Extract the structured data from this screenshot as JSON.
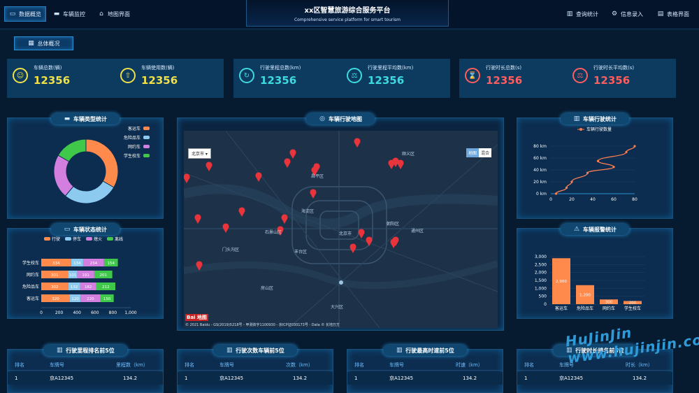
{
  "header": {
    "title": "xx区智慧旅游综合服务平台",
    "subtitle": "Comprehensive service platform for smart tourism",
    "nav_left": [
      {
        "label": "数据概览",
        "icon": "monitor-icon"
      },
      {
        "label": "车辆监控",
        "icon": "car-icon"
      },
      {
        "label": "地图界面",
        "icon": "building-icon"
      }
    ],
    "nav_right": [
      {
        "label": "查询统计",
        "icon": "bar-chart-icon"
      },
      {
        "label": "信息录入",
        "icon": "gear-icon"
      },
      {
        "label": "表格界面",
        "icon": "table-icon"
      }
    ]
  },
  "overview_tab": "总体概况",
  "kpis": [
    {
      "label": "车辆总数(辆)",
      "value": "12356",
      "color": "#f0e04a"
    },
    {
      "label": "车辆使用数(辆)",
      "value": "12356",
      "color": "#f0e04a"
    },
    {
      "label": "行驶里程总数(km)",
      "value": "12356",
      "color": "#3fd9e0"
    },
    {
      "label": "行驶里程平均数(km)",
      "value": "12356",
      "color": "#3fd9e0"
    },
    {
      "label": "行驶时长总数(s)",
      "value": "12356",
      "color": "#ff5d5d"
    },
    {
      "label": "行驶时长平均数(s)",
      "value": "12356",
      "color": "#ff5d5d"
    }
  ],
  "panels": {
    "vehicle_type": "车辆类型统计",
    "vehicle_status": "车辆状态统计",
    "map": "车辆行驶地图",
    "driving": "车辆行驶统计",
    "alarm": "车辆报警统计"
  },
  "chart_data": [
    {
      "type": "pie",
      "title": "车辆类型统计",
      "categories": [
        "客运车",
        "危险品车",
        "网约车",
        "学生校车"
      ],
      "values": [
        30,
        25,
        20,
        15
      ],
      "colors": [
        "#ff8a4c",
        "#8ccaf0",
        "#d27fe0",
        "#3fc84a"
      ],
      "legend": "top-right"
    },
    {
      "type": "bar",
      "orientation": "horizontal-stacked",
      "title": "车辆状态统计",
      "categories": [
        "客运车",
        "危险品车",
        "网约车",
        "学生校车"
      ],
      "series": [
        {
          "name": "行驶",
          "values": [
            320,
            302,
            301,
            334
          ],
          "color": "#ff8a4c"
        },
        {
          "name": "停车",
          "values": [
            120,
            132,
            101,
            134
          ],
          "color": "#8ccaf0"
        },
        {
          "name": "熄火",
          "values": [
            220,
            182,
            191,
            234
          ],
          "color": "#d27fe0"
        },
        {
          "name": "离线",
          "values": [
            150,
            212,
            201,
            154
          ],
          "color": "#3fc84a"
        }
      ],
      "xlim": [
        0,
        1000
      ],
      "xticks": [
        "0",
        "200",
        "400",
        "600",
        "800",
        "1,000"
      ],
      "legend": "top"
    },
    {
      "type": "line",
      "title": "车辆行驶统计",
      "series": [
        {
          "name": "车辆行驶数量",
          "x": [
            5,
            15,
            20,
            35,
            60,
            45,
            72,
            80
          ],
          "y": [
            0,
            10,
            20,
            35,
            45,
            55,
            70,
            80
          ],
          "color": "#ff7f50"
        }
      ],
      "xlim": [
        0,
        80
      ],
      "ylim": [
        0,
        80
      ],
      "xticks": [
        "0",
        "20",
        "40",
        "60",
        "80"
      ],
      "yticks": [
        "0 km",
        "20 km",
        "40 km",
        "60 km",
        "80 km"
      ],
      "legend": "top"
    },
    {
      "type": "bar",
      "title": "车辆报警统计",
      "categories": [
        "客运车",
        "危险品车",
        "网约车",
        "学生校车"
      ],
      "values": [
        2900,
        1200,
        300,
        200
      ],
      "data_labels": [
        "2,900",
        "1,200",
        "300",
        "200"
      ],
      "ylim": [
        0,
        3000
      ],
      "yticks": [
        "0",
        "500",
        "1,000",
        "1,500",
        "2,000",
        "2,500",
        "3,000"
      ],
      "color": "#ff8a4c"
    }
  ],
  "map": {
    "city_select": "北京市",
    "map_types": [
      "地图",
      "混合"
    ],
    "place_labels": [
      "海淀区",
      "北京市",
      "朝阳区",
      "丰台区",
      "大兴区",
      "通州区",
      "顺义区",
      "门头沟区",
      "房山区",
      "昌平区",
      "石景山区"
    ],
    "copyright": "© 2021 Baidu - GS(2019)5218号 - 甲测资字1100930 - 京ICP证030173号 - Data © 长地万方",
    "logo": "Bai 地图"
  },
  "tables": [
    {
      "title": "行驶里程排名前5位",
      "headers": [
        "排名",
        "车牌号",
        "里程数（km）"
      ],
      "rows": [
        [
          "1",
          "京A12345",
          "134.2"
        ]
      ]
    },
    {
      "title": "行驶次数车辆前5位",
      "headers": [
        "排名",
        "车牌号",
        "次数（km）"
      ],
      "rows": [
        [
          "1",
          "京A12345",
          "134.2"
        ]
      ]
    },
    {
      "title": "行驶最高时速前5位",
      "headers": [
        "排名",
        "车牌号",
        "时速（km）"
      ],
      "rows": [
        [
          "1",
          "京A12345",
          "134.2"
        ]
      ]
    },
    {
      "title": "行驶时长排名前5位",
      "headers": [
        "排名",
        "车牌号",
        "时长（km）"
      ],
      "rows": [
        [
          "1",
          "京A12345",
          "134.2"
        ]
      ]
    }
  ],
  "watermark": "HuJinJin www.hujinjin.com"
}
